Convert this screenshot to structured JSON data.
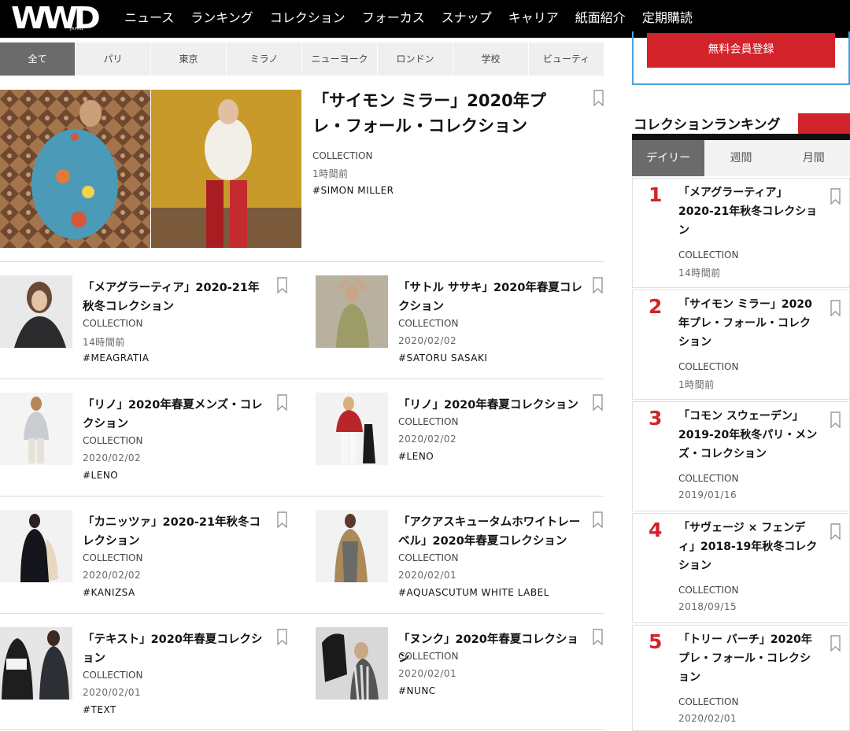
{
  "header": {
    "logo": "WWD",
    "logo_sub": "JAPAN",
    "nav": [
      "ニュース",
      "ランキング",
      "コレクション",
      "フォーカス",
      "スナップ",
      "キャリア",
      "紙面紹介",
      "定期購読"
    ]
  },
  "region_tabs": [
    "全て",
    "パリ",
    "東京",
    "ミラノ",
    "ニューヨーク",
    "ロンドン",
    "学校",
    "ビューティ"
  ],
  "hero": {
    "title": "「サイモン ミラー」2020年プレ・フォール・コレクション",
    "category": "COLLECTION",
    "date": "1時間前",
    "tag": "#SIMON MILLER"
  },
  "articles": [
    {
      "title": "「メアグラーティア」2020-21年秋冬コレクション",
      "category": "COLLECTION",
      "date": "14時間前",
      "tag": "#MEAGRATIA"
    },
    {
      "title": "「サトル ササキ」2020年春夏コレクション",
      "category": "COLLECTION",
      "date": "2020/02/02",
      "tag": "#SATORU SASAKI"
    },
    {
      "title": "「リノ」2020年春夏メンズ・コレクション",
      "category": "COLLECTION",
      "date": "2020/02/02",
      "tag": "#LENO"
    },
    {
      "title": "「リノ」2020年春夏コレクション",
      "category": "COLLECTION",
      "date": "2020/02/02",
      "tag": "#LENO"
    },
    {
      "title": "「カニッツァ」2020-21年秋冬コレクション",
      "category": "COLLECTION",
      "date": "2020/02/02",
      "tag": "#KANIZSA"
    },
    {
      "title": "「アクアスキュータムホワイトレーベル」2020年春夏コレクション",
      "category": "COLLECTION",
      "date": "2020/02/01",
      "tag": "#AQUASCUTUM WHITE LABEL"
    },
    {
      "title": "「テキスト」2020年春夏コレクション",
      "category": "COLLECTION",
      "date": "2020/02/01",
      "tag": "#TEXT"
    },
    {
      "title": "「ヌンク」2020年春夏コレクション",
      "category": "COLLECTION",
      "date": "2020/02/01",
      "tag": "#NUNC"
    }
  ],
  "sidebar": {
    "signup_label": "無料会員登録",
    "ranking_title": "コレクションランキング",
    "ranking_tabs": [
      "デイリー",
      "週間",
      "月間"
    ],
    "ranking": [
      {
        "num": "1",
        "title": "「メアグラーティア」2020-21年秋冬コレクション",
        "category": "COLLECTION",
        "date": "14時間前"
      },
      {
        "num": "2",
        "title": "「サイモン ミラー」2020年プレ・フォール・コレクション",
        "category": "COLLECTION",
        "date": "1時間前"
      },
      {
        "num": "3",
        "title": "「コモン スウェーデン」2019-20年秋冬パリ・メンズ・コレクション",
        "category": "COLLECTION",
        "date": "2019/01/16"
      },
      {
        "num": "4",
        "title": "「サヴェージ × フェンディ」2018-19年秋冬コレクション",
        "category": "COLLECTION",
        "date": "2018/09/15"
      },
      {
        "num": "5",
        "title": "「トリー バーチ」2020年プレ・フォール・コレクション",
        "category": "COLLECTION",
        "date": "2020/02/01"
      }
    ]
  },
  "colors": {
    "accent_red": "#d2232a",
    "tab_active": "#6b6b6b",
    "header_bg": "#000000"
  }
}
